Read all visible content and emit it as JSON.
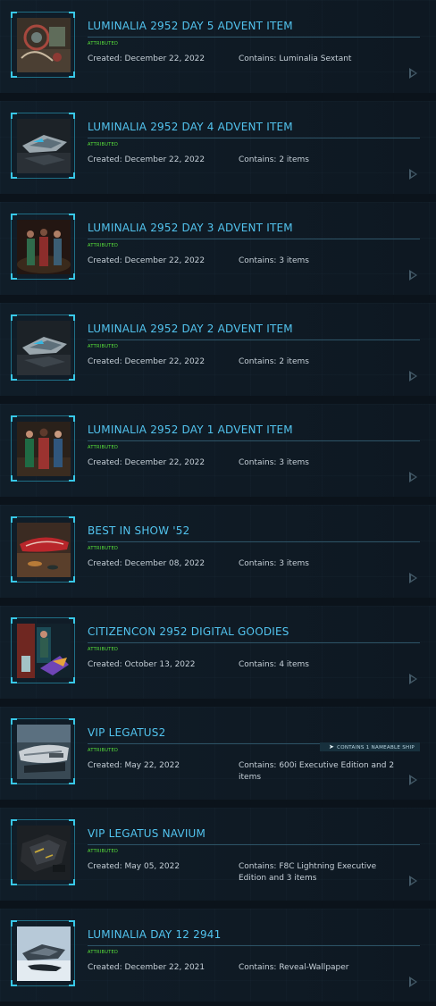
{
  "items": [
    {
      "title": "LUMINALIA 2952 DAY 5 ADVENT ITEM",
      "badge": "ATTRIBUTED",
      "created": "Created: December 22, 2022",
      "contains": "Contains: Luminalia Sextant",
      "thumb": "sextant",
      "ship_tag": ""
    },
    {
      "title": "LUMINALIA 2952 DAY 4 ADVENT ITEM",
      "badge": "ATTRIBUTED",
      "created": "Created: December 22, 2022",
      "contains": "Contains: 2 items",
      "thumb": "ship-hangar",
      "ship_tag": ""
    },
    {
      "title": "LUMINALIA 2952 DAY 3 ADVENT ITEM",
      "badge": "ATTRIBUTED",
      "created": "Created: December 22, 2022",
      "contains": "Contains: 3 items",
      "thumb": "three-figures-dark",
      "ship_tag": ""
    },
    {
      "title": "LUMINALIA 2952 DAY 2 ADVENT ITEM",
      "badge": "ATTRIBUTED",
      "created": "Created: December 22, 2022",
      "contains": "Contains: 2 items",
      "thumb": "ship-hangar",
      "ship_tag": ""
    },
    {
      "title": "LUMINALIA 2952 DAY 1 ADVENT ITEM",
      "badge": "ATTRIBUTED",
      "created": "Created: December 22, 2022",
      "contains": "Contains: 3 items",
      "thumb": "three-figures",
      "ship_tag": ""
    },
    {
      "title": "BEST IN SHOW '52",
      "badge": "ATTRIBUTED",
      "created": "Created: December 08, 2022",
      "contains": "Contains: 3 items",
      "thumb": "red-ship",
      "ship_tag": ""
    },
    {
      "title": "CITIZENCON 2952 DIGITAL GOODIES",
      "badge": "ATTRIBUTED",
      "created": "Created: October 13, 2022",
      "contains": "Contains: 4 items",
      "thumb": "citizencon",
      "ship_tag": ""
    },
    {
      "title": "VIP LEGATUS2",
      "badge": "ATTRIBUTED",
      "created": "Created: May 22, 2022",
      "contains": "Contains: 600i Executive Edition and 2 items",
      "thumb": "ship-grey",
      "ship_tag": "CONTAINS 1 NAMEABLE SHIP"
    },
    {
      "title": "VIP LEGATUS NAVIUM",
      "badge": "ATTRIBUTED",
      "created": "Created: May 05, 2022",
      "contains": "Contains: F8C Lightning Executive Edition and 3 items",
      "thumb": "ship-black",
      "ship_tag": ""
    },
    {
      "title": "LUMINALIA DAY 12 2941",
      "badge": "ATTRIBUTED",
      "created": "Created: December 22, 2021",
      "contains": "Contains: Reveal-Wallpaper",
      "thumb": "ship-snow",
      "ship_tag": ""
    }
  ],
  "icons": {
    "arrow": "play-arrow-icon",
    "ship": "ship-icon"
  },
  "colors": {
    "title": "#52c3ee",
    "badge": "#59e43a",
    "frame": "#1f6f86",
    "background": "#0b131b"
  }
}
